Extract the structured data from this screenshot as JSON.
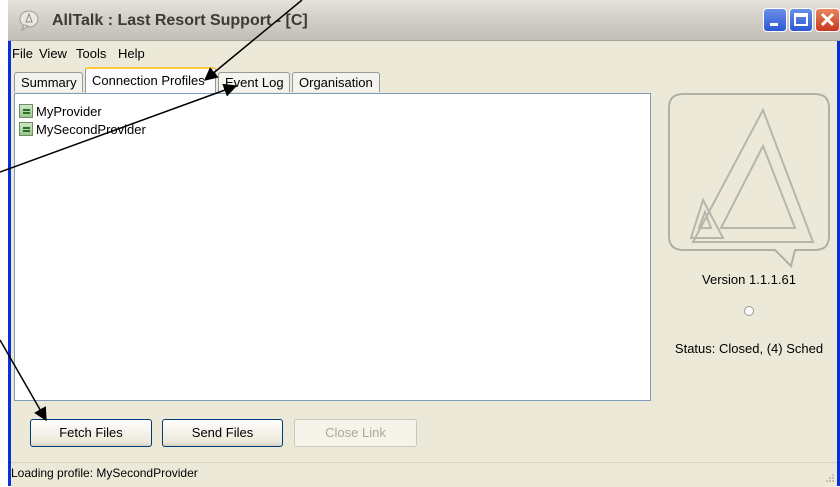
{
  "window": {
    "title": "AllTalk : Last Resort Support - [C]"
  },
  "menu": [
    "File",
    "View",
    "Tools",
    "Help"
  ],
  "tabs": [
    {
      "label": "Summary"
    },
    {
      "label": "Connection Profiles",
      "active": true
    },
    {
      "label": "Event Log"
    },
    {
      "label": "Organisation"
    }
  ],
  "profiles": [
    "MyProvider",
    "MySecondProvider"
  ],
  "side_panel": {
    "version": "Version 1.1.1.61",
    "status": "Status: Closed, (4)  Sched"
  },
  "buttons": {
    "fetch": "Fetch Files",
    "send": "Send Files",
    "close_link": "Close Link"
  },
  "status_bar": {
    "text": "Loading profile: MySecondProvider"
  },
  "icons": [
    "app-icon",
    "minimize-icon",
    "maximize-icon",
    "close-icon",
    "profile-icon",
    "logo-icon",
    "spinner-icon",
    "resize-grip-icon"
  ],
  "colors": {
    "window_face": "#ece9d8",
    "tab_highlight": "#ffc83c",
    "close_button": "#c9381c",
    "title_buttons": "#2b57d6"
  }
}
